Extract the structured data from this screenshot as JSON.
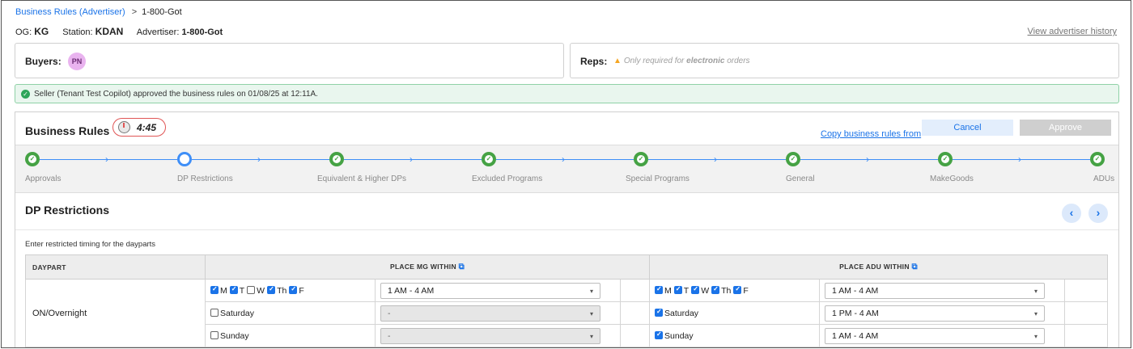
{
  "breadcrumb": {
    "parent": "Business Rules (Advertiser)",
    "sep": ">",
    "current": "1-800-Got"
  },
  "meta": {
    "og_label": "OG:",
    "og_value": "KG",
    "station_label": "Station:",
    "station_value": "KDAN",
    "advertiser_label": "Advertiser:",
    "advertiser_value": "1-800-Got"
  },
  "history_link": "View advertiser history",
  "buyers": {
    "label": "Buyers:",
    "avatar": "PN"
  },
  "reps": {
    "label": "Reps:",
    "note_prefix": "Only required for ",
    "note_bold": "electronic",
    "note_suffix": " orders"
  },
  "alert": {
    "text": "Seller (Tenant Test Copilot) approved the business rules on 01/08/25 at 12:11A."
  },
  "business_rules": {
    "title": "Business Rules",
    "timer": "4:45",
    "copy_link": "Copy business rules from",
    "cancel": "Cancel",
    "approve": "Approve"
  },
  "steps": [
    {
      "label": "Approvals",
      "state": "done"
    },
    {
      "label": "DP Restrictions",
      "state": "active"
    },
    {
      "label": "Equivalent & Higher DPs",
      "state": "done"
    },
    {
      "label": "Excluded Programs",
      "state": "done"
    },
    {
      "label": "Special Programs",
      "state": "done"
    },
    {
      "label": "General",
      "state": "done"
    },
    {
      "label": "MakeGoods",
      "state": "done"
    },
    {
      "label": "ADUs",
      "state": "done"
    }
  ],
  "dp_section": {
    "title": "DP Restrictions",
    "hint": "Enter restricted timing for the dayparts",
    "col_daypart": "DAYPART",
    "col_mg": "PLACE MG WITHIN",
    "col_adu": "PLACE ADU WITHIN",
    "daypart": "ON/Overnight",
    "mg": {
      "weekday": {
        "days": [
          {
            "d": "M",
            "on": true
          },
          {
            "d": "T",
            "on": true
          },
          {
            "d": "W",
            "on": false
          },
          {
            "d": "Th",
            "on": true
          },
          {
            "d": "F",
            "on": true
          }
        ],
        "time": "1 AM - 4 AM"
      },
      "saturday": {
        "label": "Saturday",
        "on": false,
        "time": "-"
      },
      "sunday": {
        "label": "Sunday",
        "on": false,
        "time": "-"
      }
    },
    "adu": {
      "weekday": {
        "days": [
          {
            "d": "M",
            "on": true
          },
          {
            "d": "T",
            "on": true
          },
          {
            "d": "W",
            "on": true
          },
          {
            "d": "Th",
            "on": true
          },
          {
            "d": "F",
            "on": true
          }
        ],
        "time": "1 AM - 4 AM"
      },
      "saturday": {
        "label": "Saturday",
        "on": true,
        "time": "1 PM - 4 AM"
      },
      "sunday": {
        "label": "Sunday",
        "on": true,
        "time": "1 AM - 4 AM"
      }
    }
  },
  "colors": {
    "accent": "#1a73e8",
    "success": "#45a244",
    "timer_border": "#e05555"
  }
}
